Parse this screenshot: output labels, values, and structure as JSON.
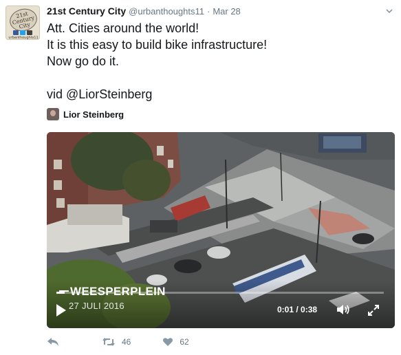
{
  "tweet": {
    "avatar": {
      "text_lines": [
        "21st",
        "Century",
        "City"
      ],
      "handle": "urbanthoughts11"
    },
    "author_name": "21st Century City",
    "author_handle": "@urbanthoughts11",
    "separator": "·",
    "date": "Mar 28",
    "text_lines": [
      "Att. Cities around the world!",
      "It is this easy to build bike infrastructure!",
      "Now go do it.",
      "",
      "vid @LiorSteinberg"
    ],
    "attribution_name": "Lior Steinberg",
    "menu_icon": "chevron-down-icon"
  },
  "video": {
    "location_title": "WEESPERPLEIN",
    "location_date": "27 JULI 2016",
    "time": "0:01 / 0:38",
    "progress": 0.026,
    "icons": [
      "play-icon",
      "volume-icon",
      "fullscreen-icon"
    ]
  },
  "actions": {
    "reply_icon": "reply-icon",
    "retweet_icon": "retweet-icon",
    "retweet_count": "46",
    "like_icon": "heart-icon",
    "like_count": "62"
  },
  "colors": {
    "text": "#14171a",
    "muted": "#657786",
    "icon": "#8899a6"
  }
}
